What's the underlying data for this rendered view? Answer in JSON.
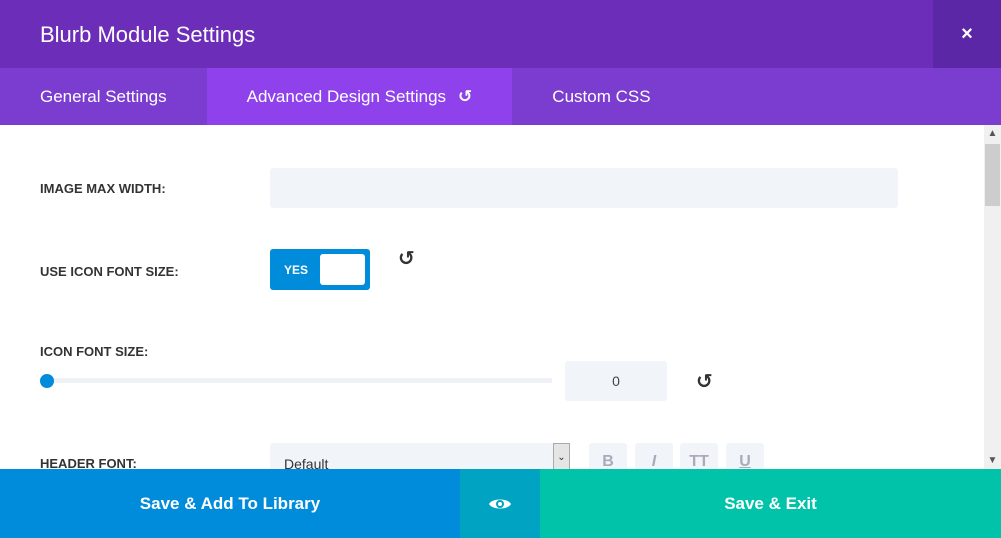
{
  "header": {
    "title": "Blurb Module Settings",
    "close_icon": "×"
  },
  "tabs": [
    {
      "label": "General Settings"
    },
    {
      "label": "Advanced Design Settings",
      "icon": "↺"
    },
    {
      "label": "Custom CSS"
    }
  ],
  "fields": {
    "image_max_width": {
      "label": "IMAGE MAX WIDTH:",
      "value": ""
    },
    "use_icon_font_size": {
      "label": "USE ICON FONT SIZE:",
      "value": "YES"
    },
    "icon_font_size": {
      "label": "ICON FONT SIZE:",
      "value": "0",
      "slider_fraction": 0
    },
    "header_font": {
      "label": "HEADER FONT:",
      "value": "Default",
      "style_buttons": [
        "B",
        "I",
        "TT",
        "U"
      ]
    }
  },
  "reset_icon": "↺",
  "footer": {
    "save_library": "Save & Add To Library",
    "preview_icon": "eye-icon",
    "save_exit": "Save & Exit"
  },
  "colors": {
    "header": "#6c2eb9",
    "tabs": "#7b3cd0",
    "active_tab": "#8f42ec",
    "blue": "#008bdb",
    "teal": "#00c3aa",
    "preview": "#00a3c2"
  }
}
